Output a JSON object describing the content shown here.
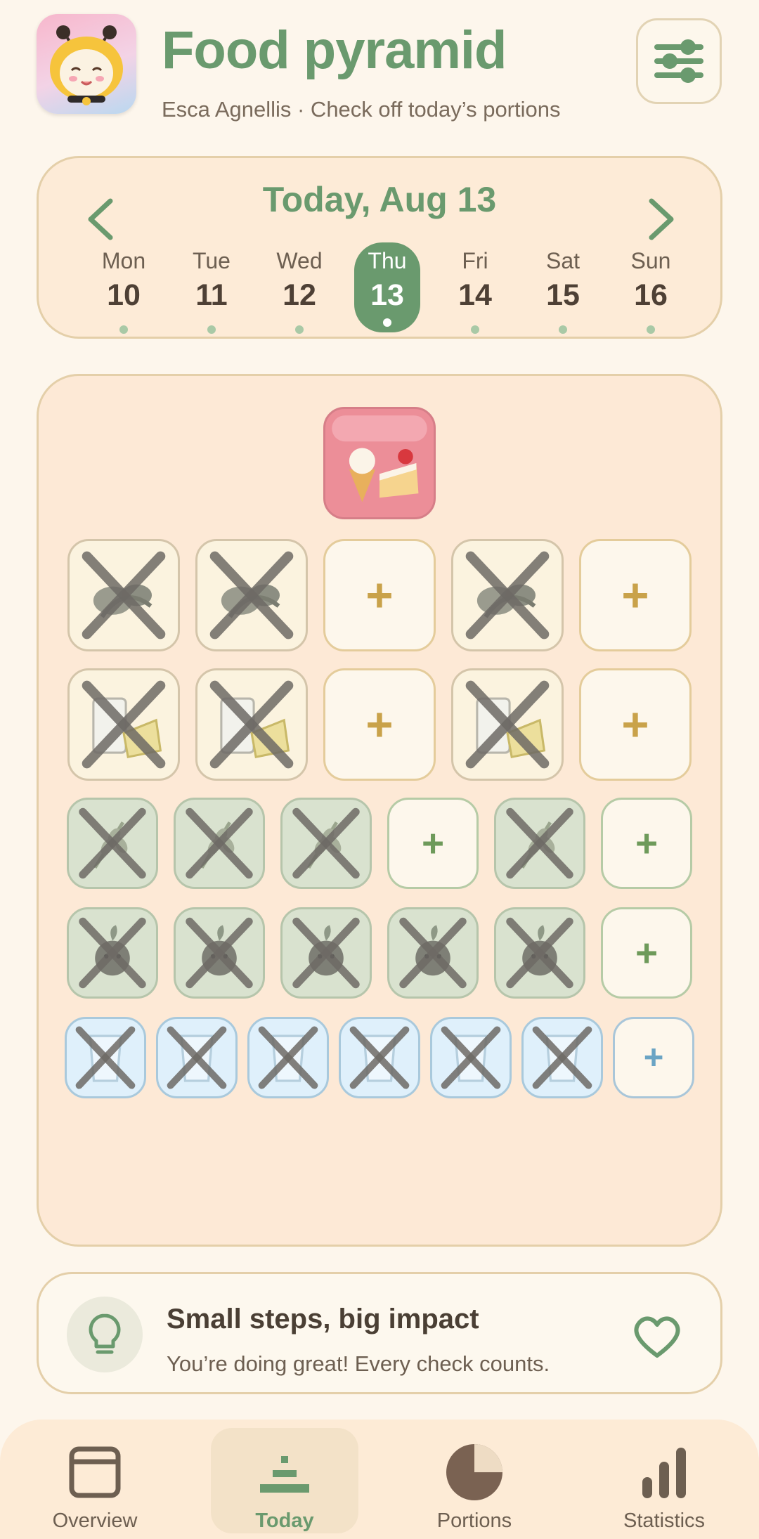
{
  "header": {
    "title": "Food pyramid",
    "subtitle": "Esca Agnellis · Check off today’s portions"
  },
  "week": {
    "title": "Today, Aug 13",
    "days": [
      {
        "name": "Mon",
        "num": "10",
        "active": false
      },
      {
        "name": "Tue",
        "num": "11",
        "active": false
      },
      {
        "name": "Wed",
        "num": "12",
        "active": false
      },
      {
        "name": "Thu",
        "num": "13",
        "active": true
      },
      {
        "name": "Fri",
        "num": "14",
        "active": false
      },
      {
        "name": "Sat",
        "num": "15",
        "active": false
      },
      {
        "name": "Sun",
        "num": "16",
        "active": false
      }
    ]
  },
  "pyramid": {
    "rows": [
      {
        "group": "sweets",
        "color": "pink",
        "slots": [
          "sweets"
        ]
      },
      {
        "group": "fats-nuts",
        "color": "yellow",
        "slots": [
          "checked",
          "checked",
          "add",
          "checked",
          "add"
        ]
      },
      {
        "group": "dairy-protein",
        "color": "yellow",
        "slots": [
          "checked",
          "checked",
          "add",
          "checked",
          "add"
        ]
      },
      {
        "group": "grains",
        "color": "green",
        "slots": [
          "checked",
          "checked",
          "checked",
          "add",
          "checked",
          "add"
        ]
      },
      {
        "group": "vegetables-fruit",
        "color": "green",
        "slots": [
          "checked",
          "checked",
          "checked",
          "checked",
          "checked",
          "add"
        ]
      },
      {
        "group": "water",
        "color": "blue",
        "slots": [
          "checked",
          "checked",
          "checked",
          "checked",
          "checked",
          "checked",
          "add"
        ]
      }
    ],
    "plus_symbol": "+",
    "colors": {
      "yellow_plus": "#c9a24a",
      "green_plus": "#6e9a5a",
      "blue_plus": "#6aa4c4",
      "cross": "#6e6a66"
    }
  },
  "tip": {
    "title": "Small steps, big impact",
    "text": "You’re doing great! Every check counts."
  },
  "nav": [
    {
      "label": "Overview",
      "active": false
    },
    {
      "label": "Today",
      "active": true
    },
    {
      "label": "Portions",
      "active": false
    },
    {
      "label": "Statistics",
      "active": false
    }
  ],
  "colors": {
    "accent": "#6a9a6e",
    "background": "#fdf6ec",
    "card": "#fdebd7"
  }
}
